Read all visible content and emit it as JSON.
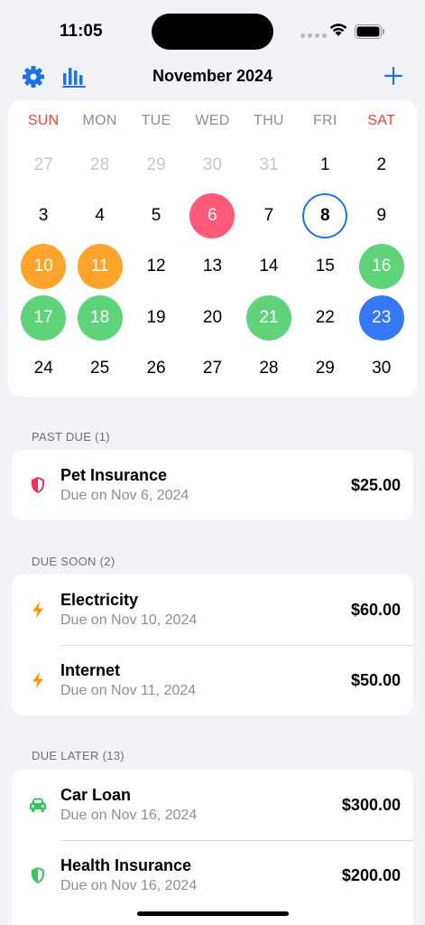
{
  "status": {
    "time": "11:05"
  },
  "nav": {
    "title": "November 2024"
  },
  "calendar": {
    "weekdays": [
      "SUN",
      "MON",
      "TUE",
      "WED",
      "THU",
      "FRI",
      "SAT"
    ],
    "days": [
      {
        "label": "27",
        "state": "other"
      },
      {
        "label": "28",
        "state": "other"
      },
      {
        "label": "29",
        "state": "other"
      },
      {
        "label": "30",
        "state": "other"
      },
      {
        "label": "31",
        "state": "other"
      },
      {
        "label": "1",
        "state": ""
      },
      {
        "label": "2",
        "state": ""
      },
      {
        "label": "3",
        "state": ""
      },
      {
        "label": "4",
        "state": ""
      },
      {
        "label": "5",
        "state": ""
      },
      {
        "label": "6",
        "state": "red"
      },
      {
        "label": "7",
        "state": ""
      },
      {
        "label": "8",
        "state": "today"
      },
      {
        "label": "9",
        "state": ""
      },
      {
        "label": "10",
        "state": "orange"
      },
      {
        "label": "11",
        "state": "orange"
      },
      {
        "label": "12",
        "state": ""
      },
      {
        "label": "13",
        "state": ""
      },
      {
        "label": "14",
        "state": ""
      },
      {
        "label": "15",
        "state": ""
      },
      {
        "label": "16",
        "state": "green"
      },
      {
        "label": "17",
        "state": "green"
      },
      {
        "label": "18",
        "state": "green"
      },
      {
        "label": "19",
        "state": ""
      },
      {
        "label": "20",
        "state": ""
      },
      {
        "label": "21",
        "state": "green"
      },
      {
        "label": "22",
        "state": ""
      },
      {
        "label": "23",
        "state": "blue"
      },
      {
        "label": "24",
        "state": ""
      },
      {
        "label": "25",
        "state": ""
      },
      {
        "label": "26",
        "state": ""
      },
      {
        "label": "27",
        "state": ""
      },
      {
        "label": "28",
        "state": ""
      },
      {
        "label": "29",
        "state": ""
      },
      {
        "label": "30",
        "state": ""
      }
    ]
  },
  "colors": {
    "accent": "#1a73e8",
    "past_due": "#ff5a78",
    "due_soon": "#ffa42b",
    "due_later": "#5fd37a",
    "selected": "#3478f6"
  },
  "sections": {
    "past_due": {
      "header": "PAST DUE (1)",
      "items": [
        {
          "name": "Pet Insurance",
          "due": "Due on Nov 6, 2024",
          "amount": "$25.00",
          "icon": "shield-icon"
        }
      ]
    },
    "due_soon": {
      "header": "DUE SOON (2)",
      "items": [
        {
          "name": "Electricity",
          "due": "Due on Nov 10, 2024",
          "amount": "$60.00",
          "icon": "bolt-icon"
        },
        {
          "name": "Internet",
          "due": "Due on Nov 11, 2024",
          "amount": "$50.00",
          "icon": "bolt-icon"
        }
      ]
    },
    "due_later": {
      "header": "DUE LATER (13)",
      "items": [
        {
          "name": "Car Loan",
          "due": "Due on Nov 16, 2024",
          "amount": "$300.00",
          "icon": "car-icon"
        },
        {
          "name": "Health Insurance",
          "due": "Due on Nov 16, 2024",
          "amount": "$200.00",
          "icon": "shield-icon"
        }
      ]
    }
  }
}
